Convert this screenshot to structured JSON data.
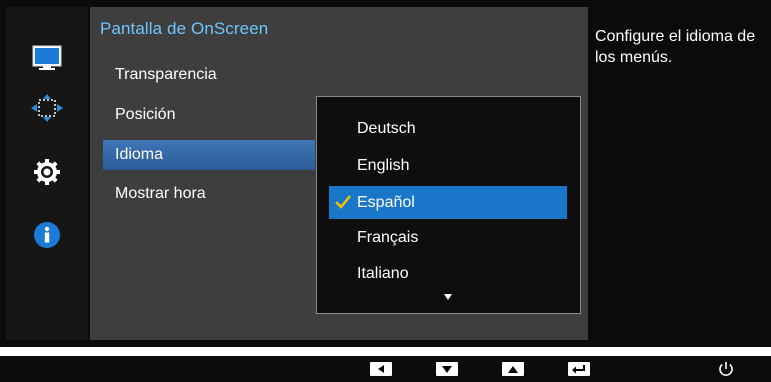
{
  "menu": {
    "title": "Pantalla de OnScreen",
    "items": [
      {
        "label": "Transparencia"
      },
      {
        "label": "Posición"
      },
      {
        "label": "Idioma",
        "selected": true
      },
      {
        "label": "Mostrar hora"
      }
    ]
  },
  "dropdown": {
    "options": [
      {
        "label": "Deutsch"
      },
      {
        "label": "English"
      },
      {
        "label": "Español",
        "selected": true
      },
      {
        "label": "Français"
      },
      {
        "label": "Italiano"
      }
    ],
    "more_indicator_icon": "chevron-down-icon"
  },
  "help": {
    "text": "Configure el idioma de los menús."
  },
  "sidebar_icons": [
    "picture-icon",
    "position-arrows-icon",
    "gear-icon",
    "info-icon"
  ],
  "bottom_keys": [
    "left-arrow-icon",
    "down-arrow-icon",
    "up-arrow-icon",
    "enter-icon",
    "power-icon"
  ],
  "colors": {
    "accent_blue": "#1976c9",
    "title_blue": "#6ec6ff",
    "check_yellow": "#f2c200",
    "panel_gray": "#3e3e3e"
  }
}
